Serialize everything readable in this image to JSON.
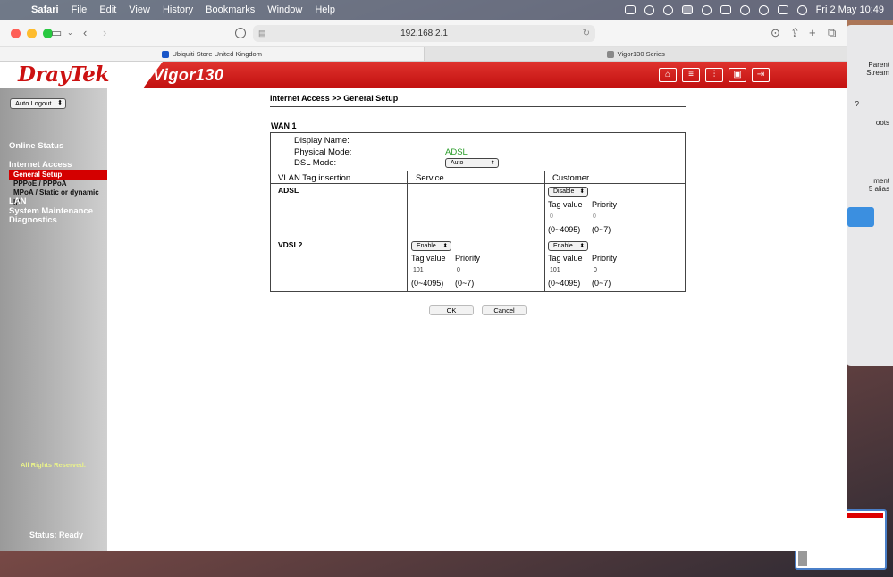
{
  "menubar": {
    "app": "Safari",
    "items": [
      "File",
      "Edit",
      "View",
      "History",
      "Bookmarks",
      "Window",
      "Help"
    ],
    "datetime": "Fri 2 May  10:49"
  },
  "browser": {
    "url": "192.168.2.1",
    "tabs": [
      {
        "label": "Ubiquiti Store United Kingdom",
        "favicon": "ubiquiti-icon"
      },
      {
        "label": "Vigor130 Series",
        "favicon": "page-icon"
      }
    ]
  },
  "background_windows": {
    "snippets": [
      "Parent",
      "Stream",
      "?",
      "oots",
      "ment",
      "5 alias"
    ]
  },
  "router": {
    "brand": "DrayTek",
    "model": "Vigor130",
    "header_icons": [
      "home-icon",
      "menu-icon",
      "settings-icon",
      "save-icon",
      "logout-icon"
    ],
    "auto_logout": "Auto Logout",
    "nav": {
      "online_status": "Online Status",
      "internet_access": "Internet Access",
      "sub": [
        "General Setup",
        "PPPoE / PPPoA",
        "MPoA / Static or dynamic IP"
      ],
      "lan": "LAN",
      "system_maintenance": "System Maintenance",
      "diagnostics": "Diagnostics"
    },
    "rights": "All Rights Reserved.",
    "status": "Status: Ready"
  },
  "page": {
    "breadcrumb": "Internet Access >> General Setup",
    "wan_title": "WAN 1",
    "display_name_label": "Display Name:",
    "display_name_value": "",
    "physical_mode_label": "Physical Mode:",
    "physical_mode_value": "ADSL",
    "dsl_mode_label": "DSL Mode:",
    "dsl_mode_value": "Auto",
    "columns": {
      "vlan": "VLAN Tag insertion",
      "service": "Service",
      "customer": "Customer"
    },
    "adsl": {
      "label": "ADSL",
      "customer_select": "Disable",
      "tag_label": "Tag value",
      "priority_label": "Priority",
      "tag_value": "0",
      "priority_value": "0",
      "tag_range": "(0~4095)",
      "priority_range": "(0~7)"
    },
    "vdsl2": {
      "label": "VDSL2",
      "service_select": "Enable",
      "service_tag_value": "101",
      "service_priority_value": "0",
      "customer_select": "Enable",
      "customer_tag_value": "101",
      "customer_priority_value": "0",
      "tag_label": "Tag value",
      "priority_label": "Priority",
      "tag_range": "(0~4095)",
      "priority_range": "(0~7)"
    },
    "ok": "OK",
    "cancel": "Cancel"
  }
}
